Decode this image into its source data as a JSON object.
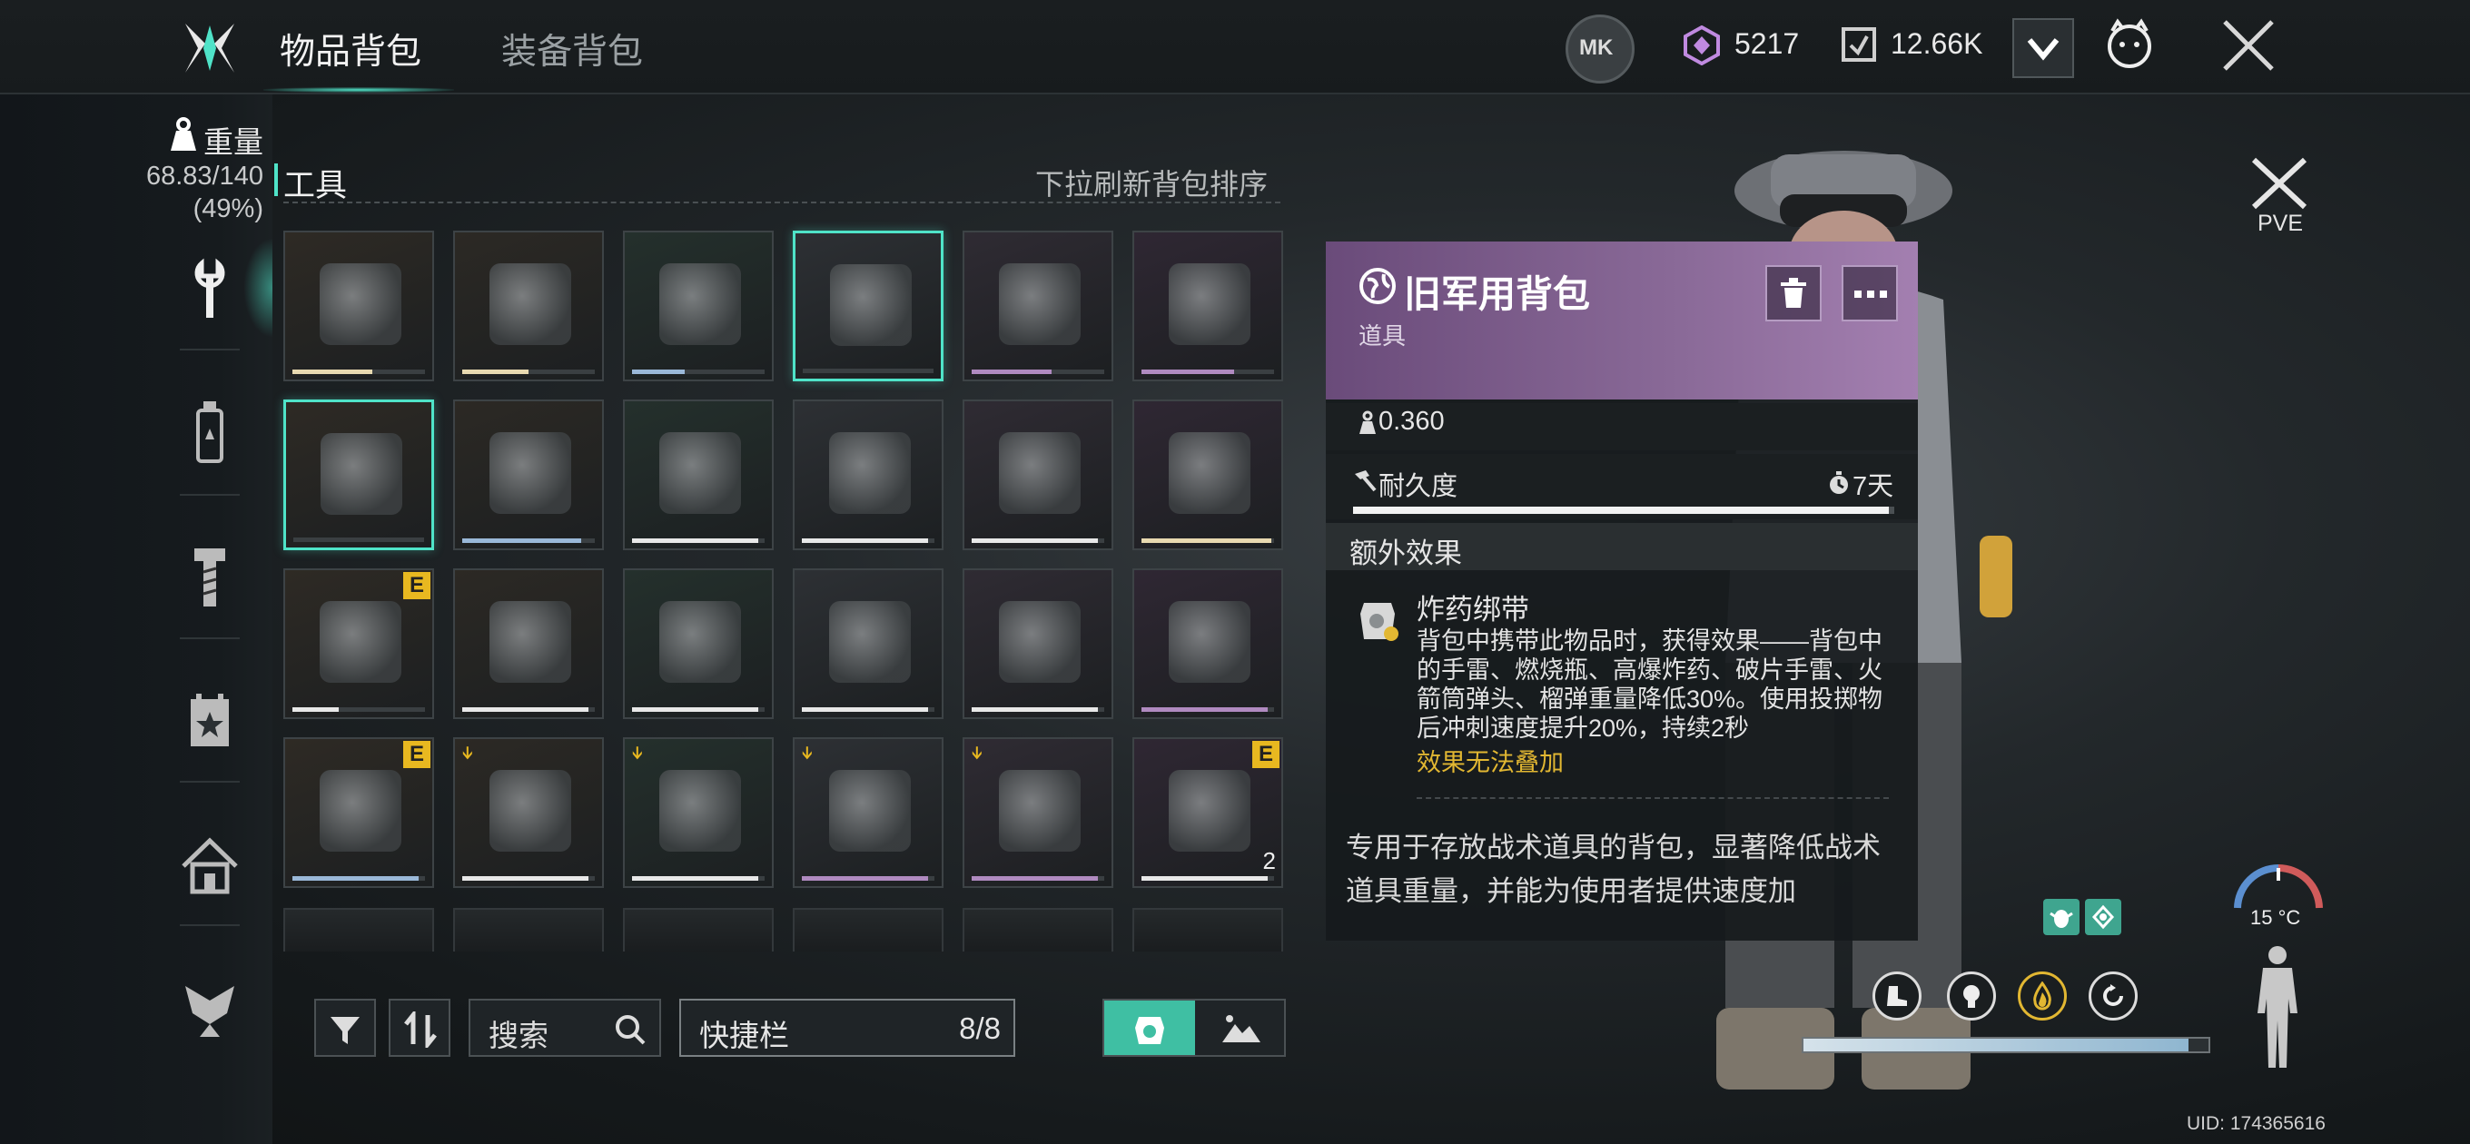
{
  "header": {
    "tabs": [
      {
        "label": "物品背包",
        "active": true
      },
      {
        "label": "装备背包",
        "active": false
      }
    ],
    "currency_1": "5217",
    "currency_2": "12.66K",
    "icons": [
      "logo-icon",
      "mk-icon",
      "gem-currency-icon",
      "token-currency-icon",
      "chevron-down-icon",
      "mascot-icon",
      "close-icon"
    ]
  },
  "sidebar": {
    "weight_label": "重量",
    "weight_value": "68.83/140",
    "weight_percent": "(49%)",
    "categories": [
      "wrench-icon",
      "bottle-icon",
      "bolt-icon",
      "calendar-star-icon",
      "home-icon",
      "wings-icon"
    ]
  },
  "inventory": {
    "category_title": "工具",
    "sort_hint": "下拉刷新背包排序",
    "items": [
      {
        "name": "vest",
        "durability": 0.6,
        "rarity": "#e8d9b0"
      },
      {
        "name": "knife",
        "durability": 0.5,
        "rarity": "#e8d9b0"
      },
      {
        "name": "chainsaw",
        "durability": 0.4,
        "rarity": "#9ab8d8"
      },
      {
        "name": "backpack",
        "durability": 0.0,
        "rarity": "#b08ac0",
        "selected": true
      },
      {
        "name": "ammo-box",
        "durability": 0.6,
        "rarity": "#b08ac0"
      },
      {
        "name": "red-chainsaw",
        "durability": 0.7,
        "rarity": "#b08ac0"
      },
      {
        "name": "claw-blade",
        "durability": 0.0,
        "rarity": "#b08ac0",
        "selected": true
      },
      {
        "name": "frying-pan",
        "durability": 0.9,
        "rarity": "#9ab8d8"
      },
      {
        "name": "water-bottle",
        "durability": 0.95,
        "rarity": "#e8e8e8"
      },
      {
        "name": "water-bottle",
        "durability": 0.95,
        "rarity": "#e8e8e8"
      },
      {
        "name": "kettle",
        "durability": 0.95,
        "rarity": "#e8e8e8"
      },
      {
        "name": "axe",
        "durability": 0.98,
        "rarity": "#e8d9b0"
      },
      {
        "name": "wrench",
        "durability": 0.35,
        "rarity": "#e8e8e8",
        "badge": "E"
      },
      {
        "name": "wrench",
        "durability": 0.95,
        "rarity": "#e8e8e8"
      },
      {
        "name": "wrench",
        "durability": 0.95,
        "rarity": "#e8e8e8"
      },
      {
        "name": "wrench",
        "durability": 0.95,
        "rarity": "#e8e8e8"
      },
      {
        "name": "wrench",
        "durability": 0.95,
        "rarity": "#e8e8e8"
      },
      {
        "name": "ray-gun",
        "durability": 0.95,
        "rarity": "#b08ac0"
      },
      {
        "name": "spear",
        "durability": 0.95,
        "rarity": "#9ab8d8",
        "badge": "E"
      },
      {
        "name": "hammer",
        "durability": 0.95,
        "rarity": "#e8e8e8",
        "tag": "ᛎ"
      },
      {
        "name": "hammer",
        "durability": 0.95,
        "rarity": "#e8e8e8",
        "tag": "ᛎ"
      },
      {
        "name": "drill",
        "durability": 0.95,
        "rarity": "#b08ac0",
        "tag": "ᛎ"
      },
      {
        "name": "chainsaw-purple",
        "durability": 0.95,
        "rarity": "#b08ac0",
        "tag": "ᛎ"
      },
      {
        "name": "grenade",
        "durability": 0.95,
        "rarity": "#e8e8e8",
        "badge": "E",
        "qty": "2"
      }
    ]
  },
  "toolbar": {
    "search_label": "搜索",
    "quickbar_label": "快捷栏",
    "quickbar_count": "8/8"
  },
  "detail": {
    "title": "旧军用背包",
    "subtitle": "道具",
    "weight": "0.360",
    "durability_label": "耐久度",
    "durability_time": "7天",
    "durability_fill": 0.99,
    "extra_effect_header": "额外效果",
    "effect_name": "炸药绑带",
    "effect_desc": "背包中携带此物品时，获得效果——背包中的手雷、燃烧瓶、高爆炸药、破片手雷、火箭筒弹头、榴弹重量降低30%。使用投掷物后冲刺速度提升20%，持续2秒",
    "effect_warning": "效果无法叠加",
    "description": "专用于存放战术道具的背包，显著降低战术道具重量，并能为使用者提供速度加"
  },
  "character": {
    "mode_label": "PVE",
    "temperature": "15 °C",
    "uid": "UID: 174365616"
  }
}
